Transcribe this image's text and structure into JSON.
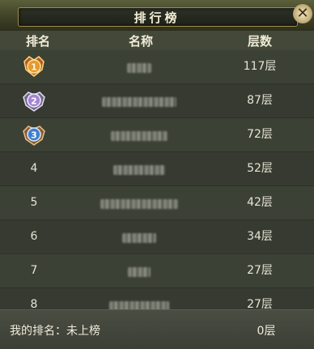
{
  "panel": {
    "title": "排行榜",
    "close_label": "✕"
  },
  "columns": {
    "rank": "排名",
    "name": "名称",
    "floor": "层数"
  },
  "rows": [
    {
      "rank": "1",
      "medal": "gold-medal-icon",
      "floor": "117层"
    },
    {
      "rank": "2",
      "medal": "silver-medal-icon",
      "floor": "87层"
    },
    {
      "rank": "3",
      "medal": "bronze-medal-icon",
      "floor": "72层"
    },
    {
      "rank": "4",
      "floor": "52层"
    },
    {
      "rank": "5",
      "floor": "42层"
    },
    {
      "rank": "6",
      "floor": "34层"
    },
    {
      "rank": "7",
      "floor": "27层"
    },
    {
      "rank": "8",
      "floor": "27层"
    }
  ],
  "footer": {
    "my_rank": "我的排名：未上榜",
    "my_floor": "0层"
  },
  "colors": {
    "gold": "#c9862a",
    "silver": "#b6a3d6",
    "bronze": "#4d8fd6"
  }
}
